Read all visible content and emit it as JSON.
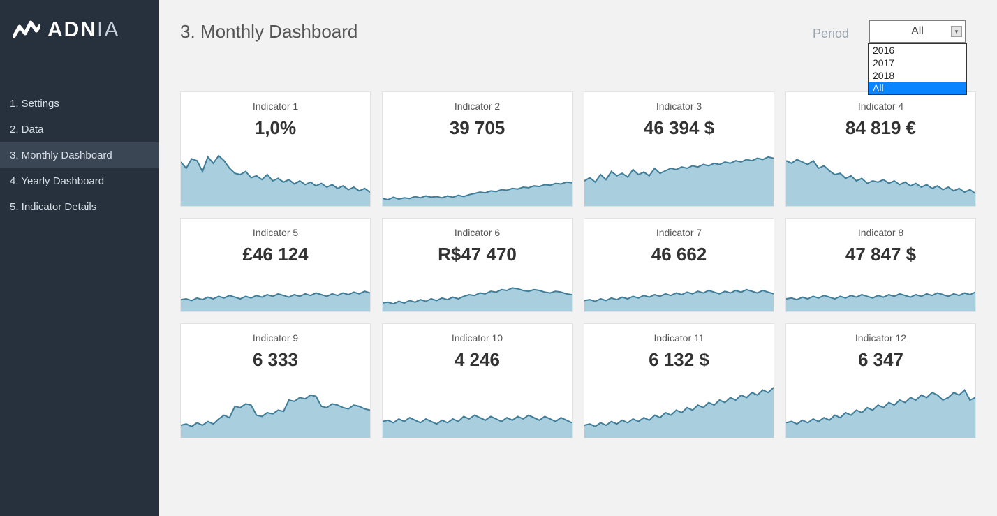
{
  "brand": {
    "name_bold": "ADN",
    "name_thin": "IA"
  },
  "sidebar": {
    "items": [
      {
        "label": "1. Settings"
      },
      {
        "label": "2. Data"
      },
      {
        "label": "3. Monthly Dashboard"
      },
      {
        "label": "4. Yearly Dashboard"
      },
      {
        "label": "5. Indicator Details"
      }
    ],
    "active_index": 2
  },
  "header": {
    "title": "3. Monthly Dashboard",
    "period_label": "Period",
    "period_value": "All",
    "period_options": [
      "2016",
      "2017",
      "2018",
      "All"
    ],
    "period_selected_index": 3
  },
  "cards": [
    {
      "title": "Indicator 1",
      "value": "1,0%"
    },
    {
      "title": "Indicator 2",
      "value": "39 705"
    },
    {
      "title": "Indicator 3",
      "value": "46 394 $"
    },
    {
      "title": "Indicator 4",
      "value": "84 819 €"
    },
    {
      "title": "Indicator 5",
      "value": "£46 124"
    },
    {
      "title": "Indicator 6",
      "value": "R$47 470"
    },
    {
      "title": "Indicator 7",
      "value": "46 662"
    },
    {
      "title": "Indicator 8",
      "value": "47 847 $"
    },
    {
      "title": "Indicator 9",
      "value": "6 333"
    },
    {
      "title": "Indicator 10",
      "value": "4 246"
    },
    {
      "title": "Indicator 11",
      "value": "6 132 $"
    },
    {
      "title": "Indicator 12",
      "value": "6 347"
    }
  ],
  "chart_data": [
    {
      "type": "area",
      "title": "Indicator 1",
      "ylim": [
        0,
        100
      ],
      "values": [
        70,
        60,
        75,
        72,
        55,
        78,
        68,
        80,
        72,
        60,
        52,
        50,
        55,
        45,
        48,
        42,
        50,
        40,
        44,
        38,
        42,
        35,
        40,
        34,
        38,
        32,
        36,
        30,
        34,
        28,
        32,
        26,
        30,
        24,
        28,
        22
      ]
    },
    {
      "type": "area",
      "title": "Indicator 2",
      "ylim": [
        0,
        100
      ],
      "values": [
        12,
        10,
        14,
        11,
        13,
        12,
        15,
        13,
        16,
        14,
        15,
        13,
        16,
        14,
        17,
        15,
        18,
        20,
        22,
        21,
        24,
        23,
        26,
        25,
        28,
        27,
        30,
        29,
        32,
        31,
        34,
        33,
        36,
        35,
        38,
        37
      ]
    },
    {
      "type": "area",
      "title": "Indicator 3",
      "ylim": [
        0,
        100
      ],
      "values": [
        40,
        45,
        38,
        50,
        42,
        55,
        48,
        52,
        46,
        58,
        50,
        54,
        48,
        60,
        52,
        56,
        60,
        58,
        62,
        60,
        64,
        62,
        66,
        64,
        68,
        66,
        70,
        68,
        72,
        70,
        74,
        72,
        76,
        74,
        78,
        76
      ]
    },
    {
      "type": "area",
      "title": "Indicator 4",
      "ylim": [
        0,
        100
      ],
      "values": [
        72,
        68,
        74,
        70,
        66,
        72,
        60,
        64,
        56,
        50,
        52,
        44,
        48,
        40,
        44,
        36,
        40,
        38,
        42,
        36,
        40,
        34,
        38,
        32,
        36,
        30,
        34,
        28,
        32,
        26,
        30,
        24,
        28,
        22,
        26,
        20
      ]
    },
    {
      "type": "area",
      "title": "Indicator 5",
      "ylim": [
        0,
        100
      ],
      "values": [
        28,
        30,
        26,
        32,
        28,
        34,
        30,
        36,
        32,
        38,
        34,
        30,
        36,
        32,
        38,
        34,
        40,
        36,
        42,
        38,
        34,
        40,
        36,
        42,
        38,
        44,
        40,
        36,
        42,
        38,
        44,
        40,
        46,
        42,
        48,
        44
      ]
    },
    {
      "type": "area",
      "title": "Indicator 6",
      "ylim": [
        0,
        100
      ],
      "values": [
        20,
        22,
        18,
        24,
        20,
        26,
        22,
        28,
        24,
        30,
        26,
        32,
        28,
        34,
        30,
        36,
        40,
        38,
        44,
        42,
        48,
        46,
        52,
        50,
        56,
        54,
        50,
        48,
        52,
        50,
        46,
        44,
        48,
        46,
        42,
        40
      ]
    },
    {
      "type": "area",
      "title": "Indicator 7",
      "ylim": [
        0,
        100
      ],
      "values": [
        26,
        28,
        24,
        30,
        26,
        32,
        28,
        34,
        30,
        36,
        32,
        38,
        34,
        40,
        36,
        42,
        38,
        44,
        40,
        46,
        42,
        48,
        44,
        50,
        46,
        42,
        48,
        44,
        50,
        46,
        52,
        48,
        44,
        50,
        46,
        42
      ]
    },
    {
      "type": "area",
      "title": "Indicator 8",
      "ylim": [
        0,
        100
      ],
      "values": [
        30,
        32,
        28,
        34,
        30,
        36,
        32,
        38,
        34,
        30,
        36,
        32,
        38,
        34,
        40,
        36,
        32,
        38,
        34,
        40,
        36,
        42,
        38,
        34,
        40,
        36,
        42,
        38,
        44,
        40,
        36,
        42,
        38,
        44,
        40,
        46
      ]
    },
    {
      "type": "area",
      "title": "Indicator 9",
      "ylim": [
        0,
        100
      ],
      "values": [
        20,
        22,
        18,
        24,
        20,
        26,
        22,
        30,
        36,
        32,
        50,
        48,
        54,
        52,
        36,
        34,
        40,
        38,
        44,
        42,
        60,
        58,
        64,
        62,
        68,
        66,
        50,
        48,
        54,
        52,
        48,
        46,
        52,
        50,
        46,
        44
      ]
    },
    {
      "type": "area",
      "title": "Indicator 10",
      "ylim": [
        0,
        100
      ],
      "values": [
        26,
        28,
        24,
        30,
        26,
        32,
        28,
        24,
        30,
        26,
        22,
        28,
        24,
        30,
        26,
        34,
        30,
        36,
        32,
        28,
        34,
        30,
        26,
        32,
        28,
        34,
        30,
        36,
        32,
        28,
        34,
        30,
        26,
        32,
        28,
        24
      ]
    },
    {
      "type": "area",
      "title": "Indicator 11",
      "ylim": [
        0,
        100
      ],
      "values": [
        20,
        22,
        18,
        24,
        20,
        26,
        22,
        28,
        24,
        30,
        26,
        32,
        28,
        36,
        32,
        40,
        36,
        44,
        40,
        48,
        44,
        52,
        48,
        56,
        52,
        60,
        56,
        64,
        60,
        68,
        64,
        72,
        68,
        76,
        72,
        80
      ]
    },
    {
      "type": "area",
      "title": "Indicator 12",
      "ylim": [
        0,
        100
      ],
      "values": [
        24,
        26,
        22,
        28,
        24,
        30,
        26,
        32,
        28,
        36,
        32,
        40,
        36,
        44,
        40,
        48,
        44,
        52,
        48,
        56,
        52,
        60,
        56,
        64,
        60,
        68,
        64,
        72,
        68,
        60,
        64,
        72,
        68,
        76,
        60,
        64
      ]
    }
  ],
  "colors": {
    "spark_fill": "#a9cfdf",
    "spark_stroke": "#3f7d99",
    "sidebar_bg": "#26313d",
    "accent": "#0a84ff"
  }
}
